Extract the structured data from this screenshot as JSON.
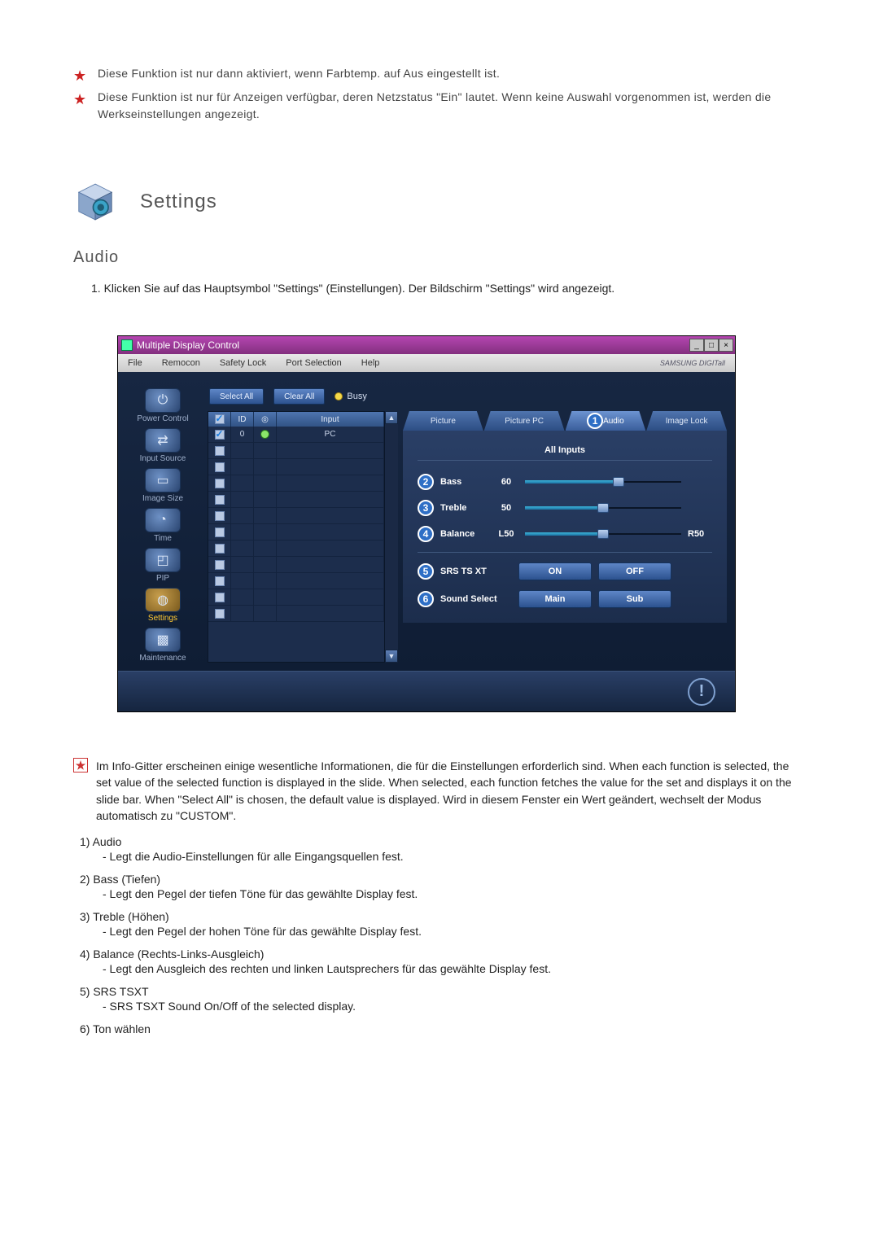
{
  "notes": {
    "n1": "Diese Funktion ist nur dann aktiviert, wenn Farbtemp. auf Aus eingestellt ist.",
    "n2": "Diese Funktion ist nur für Anzeigen verfügbar, deren Netzstatus \"Ein\" lautet. Wenn keine Auswahl vorgenommen ist, werden die Werkseinstellungen angezeigt."
  },
  "section": {
    "title": "Settings"
  },
  "subsection": {
    "title": "Audio"
  },
  "step1": "1. Klicken Sie auf das Hauptsymbol \"Settings\" (Einstellungen). Der Bildschirm \"Settings\" wird angezeigt.",
  "app": {
    "title": "Multiple Display Control",
    "menu": {
      "file": "File",
      "remocon": "Remocon",
      "safety": "Safety Lock",
      "port": "Port Selection",
      "help": "Help"
    },
    "brand": "SAMSUNG DIGITall",
    "toolbar": {
      "select_all": "Select All",
      "clear_all": "Clear All",
      "busy": "Busy"
    },
    "nav": {
      "power": "Power Control",
      "input": "Input Source",
      "image": "Image Size",
      "time": "Time",
      "pip": "PIP",
      "settings": "Settings",
      "maint": "Maintenance"
    },
    "grid": {
      "h_id": "ID",
      "h_input": "Input",
      "r0": {
        "id": "0",
        "input": "PC"
      }
    },
    "tabs": {
      "picture": "Picture",
      "picturepc": "Picture PC",
      "audio": "Audio",
      "imagelock": "Image Lock"
    },
    "panel": {
      "allinputs": "All Inputs",
      "bass": {
        "label": "Bass",
        "value": "60"
      },
      "treble": {
        "label": "Treble",
        "value": "50"
      },
      "balance": {
        "label": "Balance",
        "left": "L50",
        "right": "R50"
      },
      "srs": {
        "label": "SRS TS XT",
        "on": "ON",
        "off": "OFF"
      },
      "sound": {
        "label": "Sound Select",
        "main": "Main",
        "sub": "Sub"
      }
    }
  },
  "infopara": "Im Info-Gitter erscheinen einige wesentliche Informationen, die für die Einstellungen erforderlich sind. When each function is selected, the set value of the selected function is displayed in the slide. When selected, each function fetches the value for the set and displays it on the slide bar. When \"Select All\" is chosen, the default value is displayed. Wird in diesem Fenster ein Wert geändert, wechselt der Modus automatisch zu \"CUSTOM\".",
  "list": {
    "i1h": "1)  Audio",
    "i1s": "- Legt die Audio-Einstellungen für alle Eingangsquellen fest.",
    "i2h": "2)  Bass (Tiefen)",
    "i2s": "- Legt den Pegel der tiefen Töne für das gewählte Display fest.",
    "i3h": "3)  Treble (Höhen)",
    "i3s": "- Legt den Pegel der hohen Töne für das gewählte Display fest.",
    "i4h": "4)  Balance (Rechts-Links-Ausgleich)",
    "i4s": "- Legt den Ausgleich des rechten und linken Lautsprechers für das gewählte Display fest.",
    "i5h": "5)  SRS TSXT",
    "i5s": "- SRS TSXT Sound On/Off of the selected display.",
    "i6h": "6)  Ton wählen"
  }
}
